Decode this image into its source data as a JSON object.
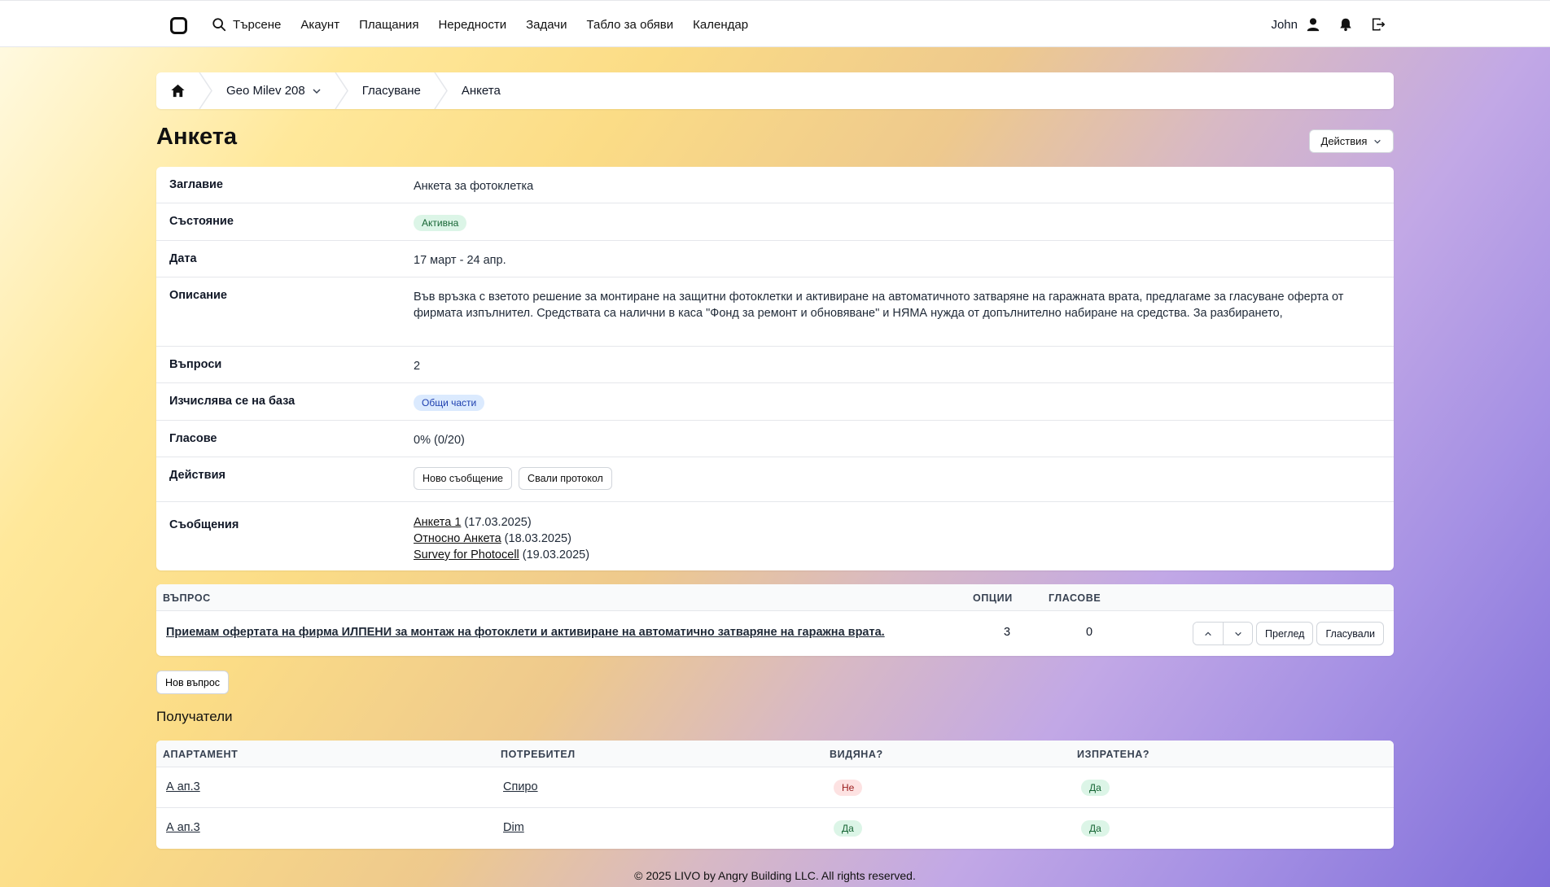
{
  "nav": {
    "search": "Търсене",
    "items": [
      "Акаунт",
      "Плащания",
      "Нередности",
      "Задачи",
      "Табло за обяви",
      "Календар"
    ],
    "user": "John"
  },
  "breadcrumb": {
    "building": "Geo Milev 208",
    "section": "Гласуване",
    "current": "Анкета"
  },
  "page": {
    "title": "Анкета",
    "actions_label": "Действия"
  },
  "details": {
    "title_label": "Заглавие",
    "title_value": "Анкета за фотоклетка",
    "status_label": "Състояние",
    "status_value": "Активна",
    "date_label": "Дата",
    "date_value": "17 март - 24 апр.",
    "description_label": "Описание",
    "description_value": "Във връзка с взетото решение за монтиране на защитни фотоклетки и активиране на автоматичното затваряне на гаражната врата, предлагаме за гласуване оферта от фирмата изпълнител. Средствата са налични в каса \"Фонд за ремонт и обновяване\" и НЯМА нужда от допълнително набиране на средства. За разбирането,",
    "questions_label": "Въпроси",
    "questions_value": "2",
    "basis_label": "Изчислява се на база",
    "basis_value": "Общи части",
    "votes_label": "Гласове",
    "votes_value": "0% (0/20)",
    "actions_label": "Действия",
    "action_new_message": "Ново съобщение",
    "action_download": "Свали протокол",
    "messages_label": "Съобщения",
    "messages": [
      {
        "link": "Анкета 1",
        "date": " (17.03.2025)"
      },
      {
        "link": "Относно Анкета",
        "date": " (18.03.2025)"
      },
      {
        "link": "Survey for Photocell",
        "date": " (19.03.2025)"
      }
    ]
  },
  "questions_table": {
    "headers": {
      "question": "ВЪПРОС",
      "options": "ОПЦИИ",
      "votes": "ГЛАСОВЕ"
    },
    "rows": [
      {
        "question": "Приемам офертата на фирма ИЛПЕНИ за монтаж на фотоклети и активиране на автоматично затваряне на гаражна врата.",
        "options": "3",
        "votes": "0",
        "view_label": "Преглед",
        "voted_label": "Гласували"
      }
    ]
  },
  "new_question_label": "Нов въпрос",
  "recipients": {
    "title": "Получатели",
    "headers": {
      "apartment": "АПАРТАМЕНТ",
      "user": "ПОТРЕБИТЕЛ",
      "seen": "ВИДЯНА?",
      "sent": "ИЗПРАТЕНА?"
    },
    "rows": [
      {
        "apartment": "А ап.3",
        "user": "Спиро",
        "seen": "Не",
        "sent": "Да"
      },
      {
        "apartment": "А ап.3",
        "user": "Dim",
        "seen": "Да",
        "sent": "Да"
      }
    ]
  },
  "footer": "© 2025 LIVO by Angry Building LLC. All rights reserved."
}
